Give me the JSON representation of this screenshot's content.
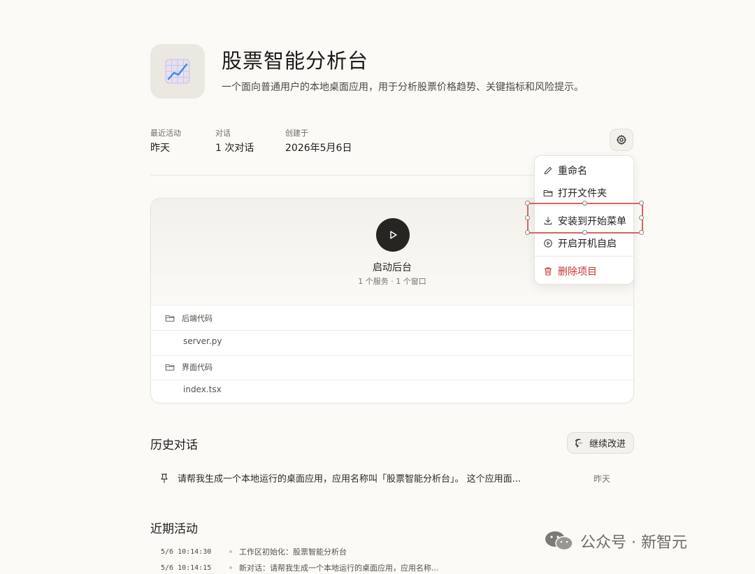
{
  "project": {
    "title": "股票智能分析台",
    "description": "一个面向普通用户的本地桌面应用，用于分析股票价格趋势、关键指标和风险提示。",
    "icon": "chart-grid-icon"
  },
  "meta": {
    "last_activity_label": "最近活动",
    "last_activity_value": "昨天",
    "conversations_label": "对话",
    "conversations_value": "1 次对话",
    "created_label": "创建于",
    "created_value": "2026年5月6日"
  },
  "settings_button": {
    "icon": "gear-icon"
  },
  "menu": {
    "items": [
      {
        "label": "重命名",
        "icon": "pencil-icon"
      },
      {
        "label": "打开文件夹",
        "icon": "folder-open-icon"
      },
      {
        "label": "安装到开始菜单",
        "icon": "download-icon"
      },
      {
        "label": "开启开机自启",
        "icon": "play-circle-icon"
      },
      {
        "label": "删除项目",
        "icon": "trash-icon",
        "color": "#c8332e"
      }
    ]
  },
  "card": {
    "run_title": "启动后台",
    "run_subtitle": "1 个服务 · 1 个窗口",
    "groups": [
      {
        "label": "后端代码",
        "file": "server.py"
      },
      {
        "label": "界面代码",
        "file": "index.tsx"
      }
    ]
  },
  "history": {
    "title": "历史对话",
    "continue_label": "继续改进",
    "conversation_text": "请帮我生成一个本地运行的桌面应用，应用名称叫「股票智能分析台」。 这个应用面...",
    "conversation_time": "昨天"
  },
  "activity": {
    "title": "近期活动",
    "entries": [
      {
        "time": "5/6 10:14:30",
        "text": "工作区初始化：股票智能分析台"
      },
      {
        "time": "5/6 10:14:15",
        "text": "新对话：请帮我生成一个本地运行的桌面应用，应用名称..."
      }
    ]
  },
  "watermark": {
    "text": "公众号 · 新智元"
  },
  "colors": {
    "accent_danger": "#c8332e",
    "selection": "#d9635f",
    "background": "#fbfaf7"
  }
}
